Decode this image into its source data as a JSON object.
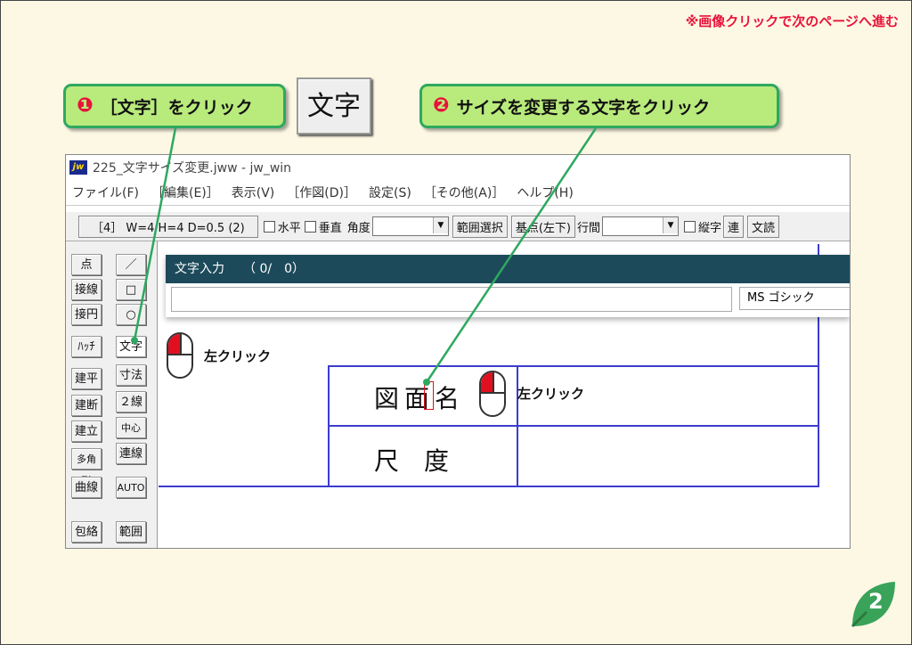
{
  "header": {
    "note": "※画像クリックで次のページへ進む"
  },
  "callouts": [
    {
      "num": "❶",
      "text": "［文字］をクリック"
    },
    {
      "num": "❷",
      "text": "サイズを変更する文字をクリック"
    }
  ],
  "big_button": {
    "label": "文字"
  },
  "window": {
    "title": "225_文字サイズ変更.jww - jw_win",
    "menu": [
      "ファイル(F)",
      "［編集(E)］",
      "表示(V)",
      "［作図(D)］",
      "設定(S)",
      "［その他(A)］",
      "ヘルプ(H)"
    ],
    "toolbar": {
      "layer": "［4］ W=4 H=4 D=0.5 (2)",
      "horizontal": "水平",
      "vertical": "垂直",
      "angle": "角度",
      "range_select": "範囲選択",
      "base_point": "基点(左下)",
      "line_spacing": "行間",
      "vertical_text": "縦字",
      "continuous": "連",
      "read_text": "文読"
    },
    "left_tools_col1": [
      "点",
      "接線",
      "接円",
      "ﾊｯﾁ",
      "建平",
      "建断",
      "建立",
      "多角形",
      "曲線",
      "包絡"
    ],
    "left_tools_col2": [
      "／",
      "□",
      "○",
      "文字",
      "寸法",
      "２線",
      "中心線",
      "連線",
      "AUTO",
      "範囲"
    ],
    "dialog": {
      "title": "文字入力　　（ 0/　0）",
      "font": "MS ゴシック",
      "input_value": ""
    },
    "drawing": {
      "row1": "図面名",
      "row2": "尺　度"
    }
  },
  "click_labels": [
    "左クリック",
    "左クリック"
  ],
  "page_number": "2",
  "colors": {
    "accent_red": "#e8123a",
    "callout_green": "#b9ea7c",
    "callout_border": "#2ea860",
    "drawing_blue": "#3c3cd0",
    "dialog_title": "#1c4a5a"
  }
}
